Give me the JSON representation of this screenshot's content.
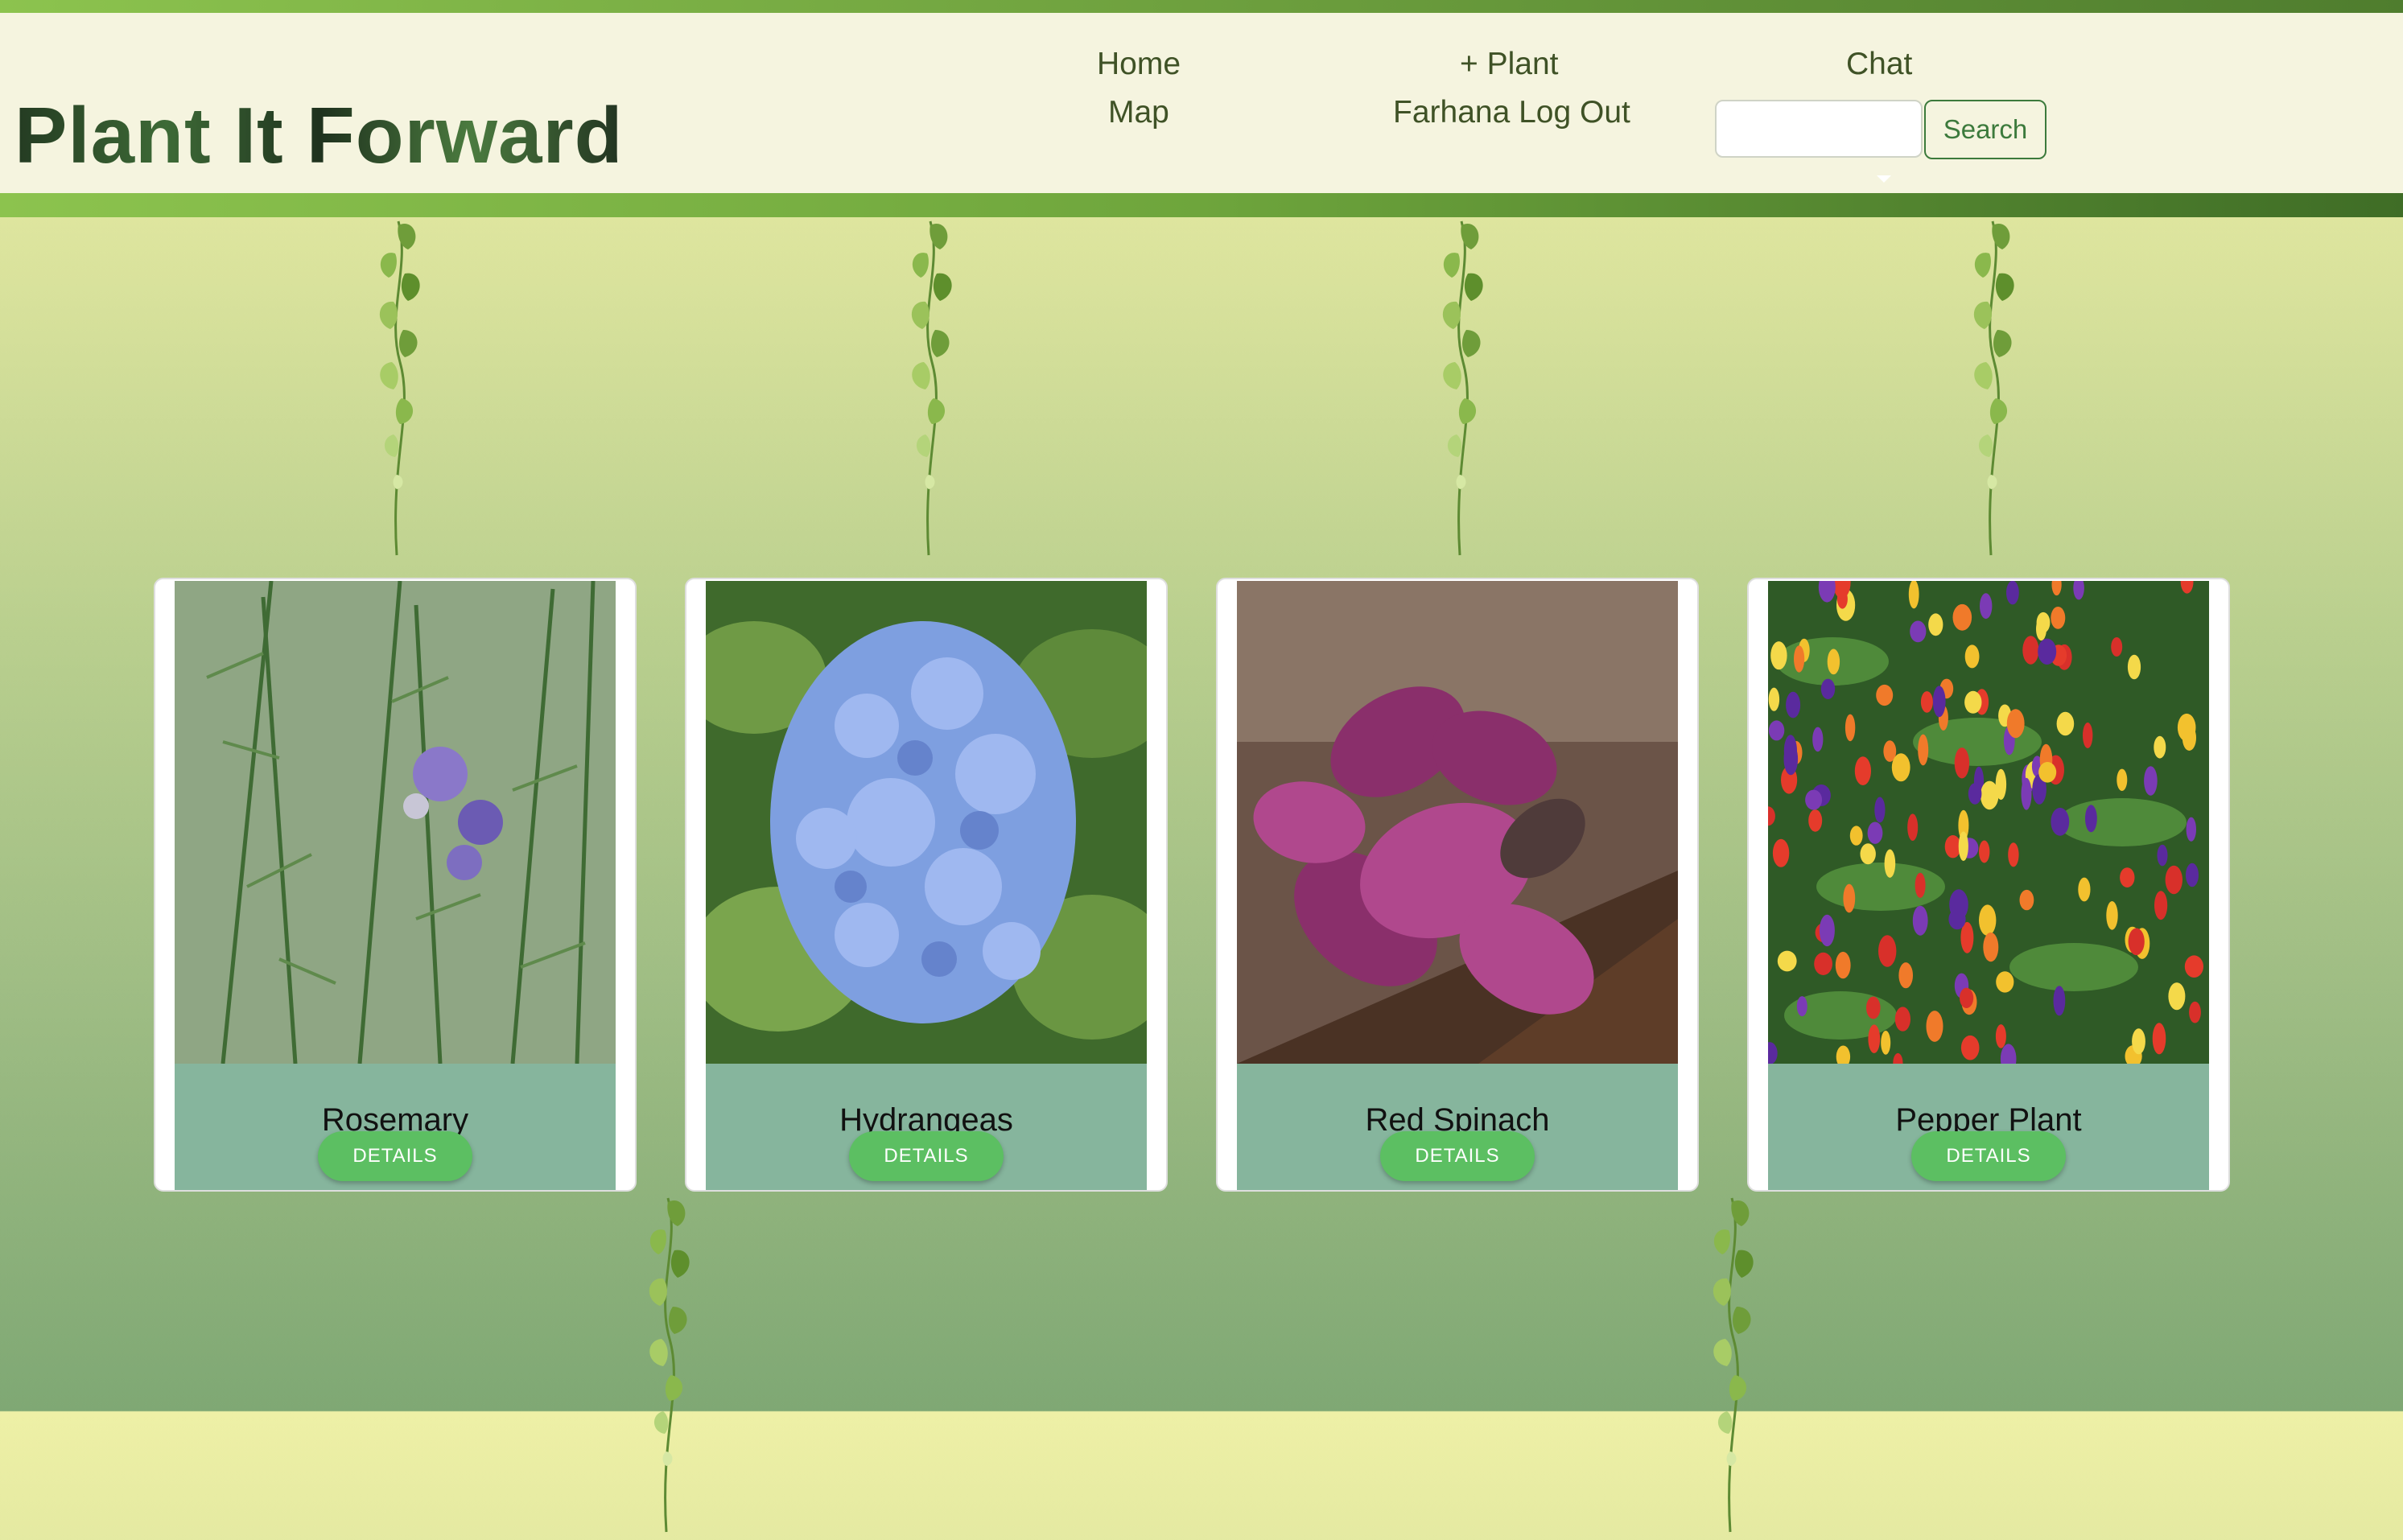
{
  "header": {
    "brand": "Plant It Forward",
    "nav": {
      "home": "Home",
      "map": "Map",
      "add_plant": "+ Plant",
      "logout": "Farhana Log Out",
      "chat": "Chat"
    },
    "search": {
      "value": "",
      "placeholder": "",
      "button_label": "Search"
    }
  },
  "cards": [
    {
      "name": "Rosemary",
      "button_label": "DETAILS"
    },
    {
      "name": "Hydrangeas",
      "button_label": "DETAILS"
    },
    {
      "name": "Red Spinach",
      "button_label": "DETAILS"
    },
    {
      "name": "Pepper Plant",
      "button_label": "DETAILS"
    }
  ],
  "colors": {
    "header_bg": "#f5f4df",
    "accent_green": "#5cbf62",
    "card_info_bg": "#86b59d",
    "nav_text": "#3f5226"
  },
  "icons": [
    "vine-decoration",
    "dropdown-caret-icon"
  ]
}
